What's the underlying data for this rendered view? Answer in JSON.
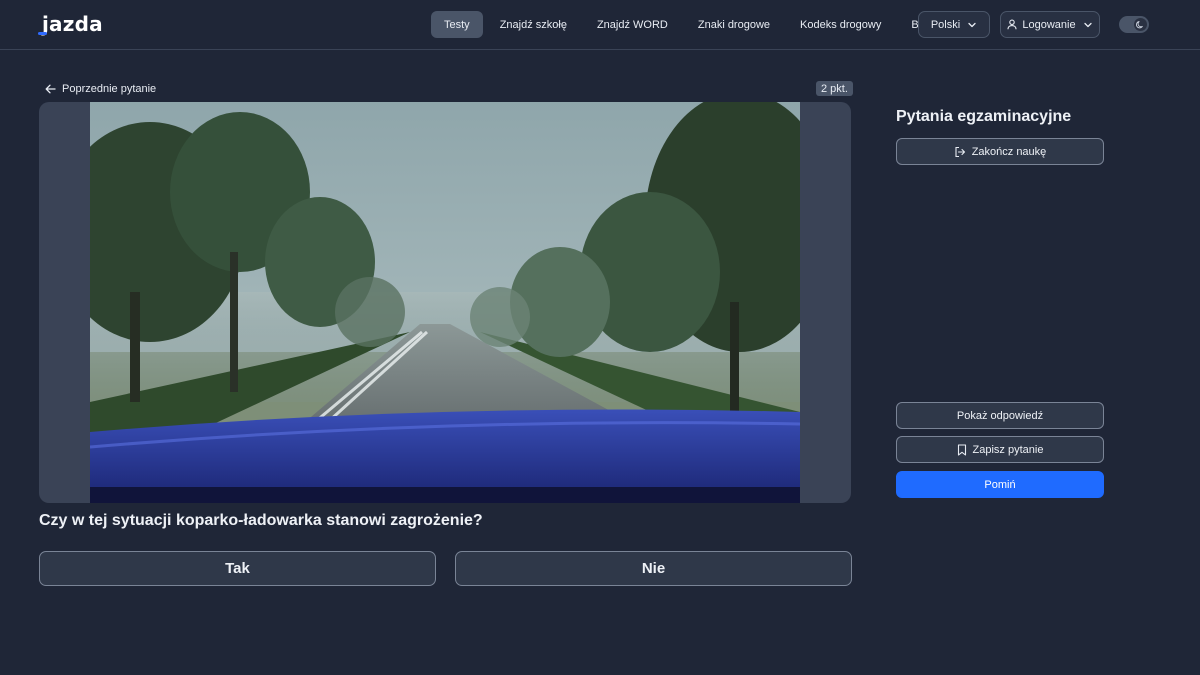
{
  "header": {
    "logo_text": "jazda",
    "nav": [
      {
        "label": "Testy",
        "active": true
      },
      {
        "label": "Znajdź szkołę"
      },
      {
        "label": "Znajdź WORD"
      },
      {
        "label": "Znaki drogowe"
      },
      {
        "label": "Kodeks drogowy"
      },
      {
        "label": "Blog"
      }
    ],
    "language": "Polski",
    "login": "Logowanie",
    "theme_toggle_icon": "moon-icon"
  },
  "main": {
    "prev_label": "Poprzednie pytanie",
    "points": "2 pkt.",
    "question": "Czy w tej sytuacji koparko-ładowarka stanowi zagrożenie?",
    "answers": {
      "yes": "Tak",
      "no": "Nie"
    }
  },
  "side": {
    "title": "Pytania egzaminacyjne",
    "end_label": "Zakończ naukę",
    "show_answer_label": "Pokaż odpowiedź",
    "save_label": "Zapisz pytanie",
    "skip_label": "Pomiń"
  },
  "colors": {
    "background": "#1f2637",
    "accent": "#1f6bff",
    "button_border": "#7a8496"
  }
}
